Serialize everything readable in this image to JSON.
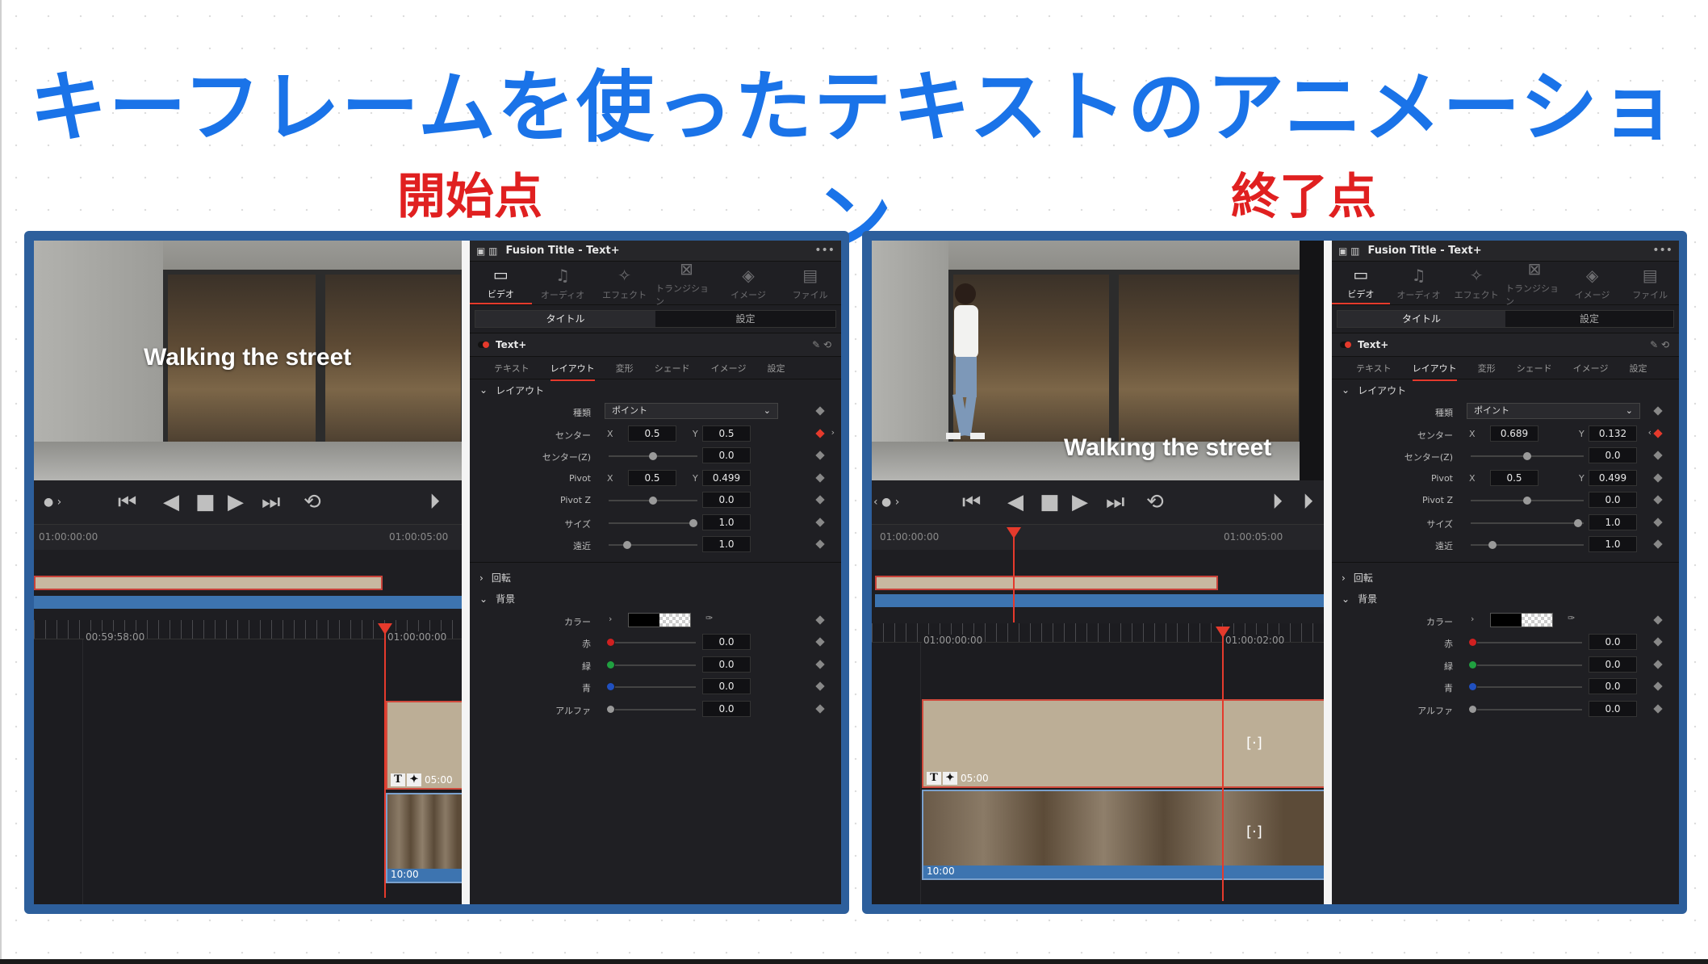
{
  "title": "キーフレームを使ったテキストのアニメーション",
  "panels": [
    {
      "heading": "開始点",
      "video_text": "Walking the street",
      "ruler": {
        "start": "01:00:00:00",
        "end": "01:00:05:00"
      },
      "timeline": {
        "left_tc": "00:59:58:00",
        "right_tc": "01:00:00:00",
        "clip_dur": "05:00",
        "video_dur": "10:00"
      },
      "inspector": {
        "title": "Fusion Title - Text+",
        "tabs": [
          "ビデオ",
          "オーディオ",
          "エフェクト",
          "トランジション",
          "イメージ",
          "ファイル"
        ],
        "segments": [
          "タイトル",
          "設定"
        ],
        "node": "Text+",
        "subtabs": [
          "テキスト",
          "レイアウト",
          "変形",
          "シェード",
          "イメージ",
          "設定"
        ],
        "layout_section": "レイアウト",
        "type_label": "種類",
        "type_value": "ポイント",
        "center_label": "センター",
        "center_x": "0.5",
        "center_y": "0.5",
        "center_z_label": "センター(Z)",
        "center_z": "0.0",
        "pivot_label": "Pivot",
        "pivot_x": "0.5",
        "pivot_y": "0.499",
        "pivot_z_label": "Pivot Z",
        "pivot_z": "0.0",
        "size_label": "サイズ",
        "size": "1.0",
        "perspective_label": "遠近",
        "perspective": "1.0",
        "rotation_section": "回転",
        "bg_section": "背景",
        "color_label": "カラー",
        "red_label": "赤",
        "red": "0.0",
        "green_label": "緑",
        "green": "0.0",
        "blue_label": "青",
        "blue": "0.0",
        "alpha_label": "アルファ",
        "alpha": "0.0",
        "x_axis": "X",
        "y_axis": "Y"
      }
    },
    {
      "heading": "終了点",
      "video_text": "Walking the street",
      "ruler": {
        "start": "01:00:00:00",
        "end": "01:00:05:00"
      },
      "timeline": {
        "left_tc": "01:00:00:00",
        "right_tc": "01:00:02:00",
        "clip_dur": "05:00",
        "video_dur": "10:00"
      },
      "inspector": {
        "title": "Fusion Title - Text+",
        "tabs": [
          "ビデオ",
          "オーディオ",
          "エフェクト",
          "トランジション",
          "イメージ",
          "ファイル"
        ],
        "segments": [
          "タイトル",
          "設定"
        ],
        "node": "Text+",
        "subtabs": [
          "テキスト",
          "レイアウト",
          "変形",
          "シェード",
          "イメージ",
          "設定"
        ],
        "layout_section": "レイアウト",
        "type_label": "種類",
        "type_value": "ポイント",
        "center_label": "センター",
        "center_x": "0.689",
        "center_y": "0.132",
        "center_z_label": "センター(Z)",
        "center_z": "0.0",
        "pivot_label": "Pivot",
        "pivot_x": "0.5",
        "pivot_y": "0.499",
        "pivot_z_label": "Pivot Z",
        "pivot_z": "0.0",
        "size_label": "サイズ",
        "size": "1.0",
        "perspective_label": "遠近",
        "perspective": "1.0",
        "rotation_section": "回転",
        "bg_section": "背景",
        "color_label": "カラー",
        "red_label": "赤",
        "red": "0.0",
        "green_label": "緑",
        "green": "0.0",
        "blue_label": "青",
        "blue": "0.0",
        "alpha_label": "アルファ",
        "alpha": "0.0",
        "x_axis": "X",
        "y_axis": "Y"
      }
    }
  ],
  "colors": {
    "title_blue": "#1a73e8",
    "heading_red": "#e02020",
    "frame_blue": "#2d5f9c",
    "playhead": "#e53a2c"
  }
}
